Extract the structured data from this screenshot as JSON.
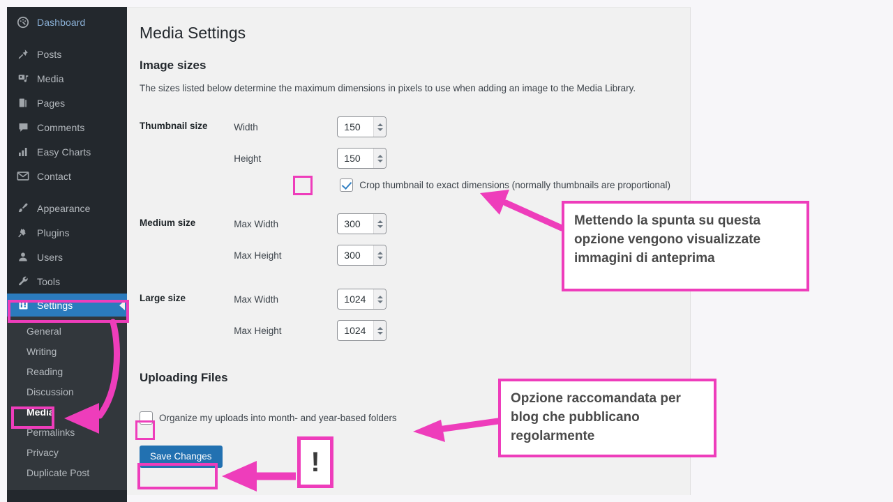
{
  "accent_color": "#ee3dbb",
  "sidebar": {
    "items": [
      {
        "label": "Dashboard",
        "icon": "dashboard-icon",
        "state": "link"
      },
      {
        "label": "Posts",
        "icon": "pin-icon",
        "state": "link"
      },
      {
        "label": "Media",
        "icon": "media-icon",
        "state": "link"
      },
      {
        "label": "Pages",
        "icon": "pages-icon",
        "state": "link"
      },
      {
        "label": "Comments",
        "icon": "comment-icon",
        "state": "link"
      },
      {
        "label": "Easy Charts",
        "icon": "bar-chart-icon",
        "state": "link"
      },
      {
        "label": "Contact",
        "icon": "envelope-icon",
        "state": "link"
      },
      {
        "label": "Appearance",
        "icon": "paintbrush-icon",
        "state": "link"
      },
      {
        "label": "Plugins",
        "icon": "plug-icon",
        "state": "link"
      },
      {
        "label": "Users",
        "icon": "user-icon",
        "state": "link"
      },
      {
        "label": "Tools",
        "icon": "wrench-icon",
        "state": "link"
      },
      {
        "label": "Settings",
        "icon": "settings-icon",
        "state": "current"
      }
    ],
    "submenu": [
      {
        "label": "General",
        "current": false
      },
      {
        "label": "Writing",
        "current": false
      },
      {
        "label": "Reading",
        "current": false
      },
      {
        "label": "Discussion",
        "current": false
      },
      {
        "label": "Media",
        "current": true
      },
      {
        "label": "Permalinks",
        "current": false
      },
      {
        "label": "Privacy",
        "current": false
      },
      {
        "label": "Duplicate Post",
        "current": false
      }
    ]
  },
  "main": {
    "page_title": "Media Settings",
    "image_sizes_heading": "Image sizes",
    "image_sizes_description": "The sizes listed below determine the maximum dimensions in pixels to use when adding an image to the Media Library.",
    "rows": [
      {
        "heading": "Thumbnail size",
        "fields": [
          {
            "label": "Width",
            "value": "150"
          },
          {
            "label": "Height",
            "value": "150"
          }
        ],
        "checkbox": {
          "label": "Crop thumbnail to exact dimensions (normally thumbnails are proportional)",
          "checked": true
        }
      },
      {
        "heading": "Medium size",
        "fields": [
          {
            "label": "Max Width",
            "value": "300"
          },
          {
            "label": "Max Height",
            "value": "300"
          }
        ]
      },
      {
        "heading": "Large size",
        "fields": [
          {
            "label": "Max Width",
            "value": "1024"
          },
          {
            "label": "Max Height",
            "value": "1024"
          }
        ]
      }
    ],
    "uploading_heading": "Uploading Files",
    "organize_checkbox": {
      "label": "Organize my uploads into month- and year-based folders",
      "checked": false
    },
    "save_label": "Save Changes"
  },
  "annotations": {
    "callout_1": "Mettendo la spunta su questa opzione vengono visualizzate immagini di anteprima",
    "callout_2": "Opzione raccomandata per blog che pubblicano regolarmente",
    "exclamation": "!"
  }
}
